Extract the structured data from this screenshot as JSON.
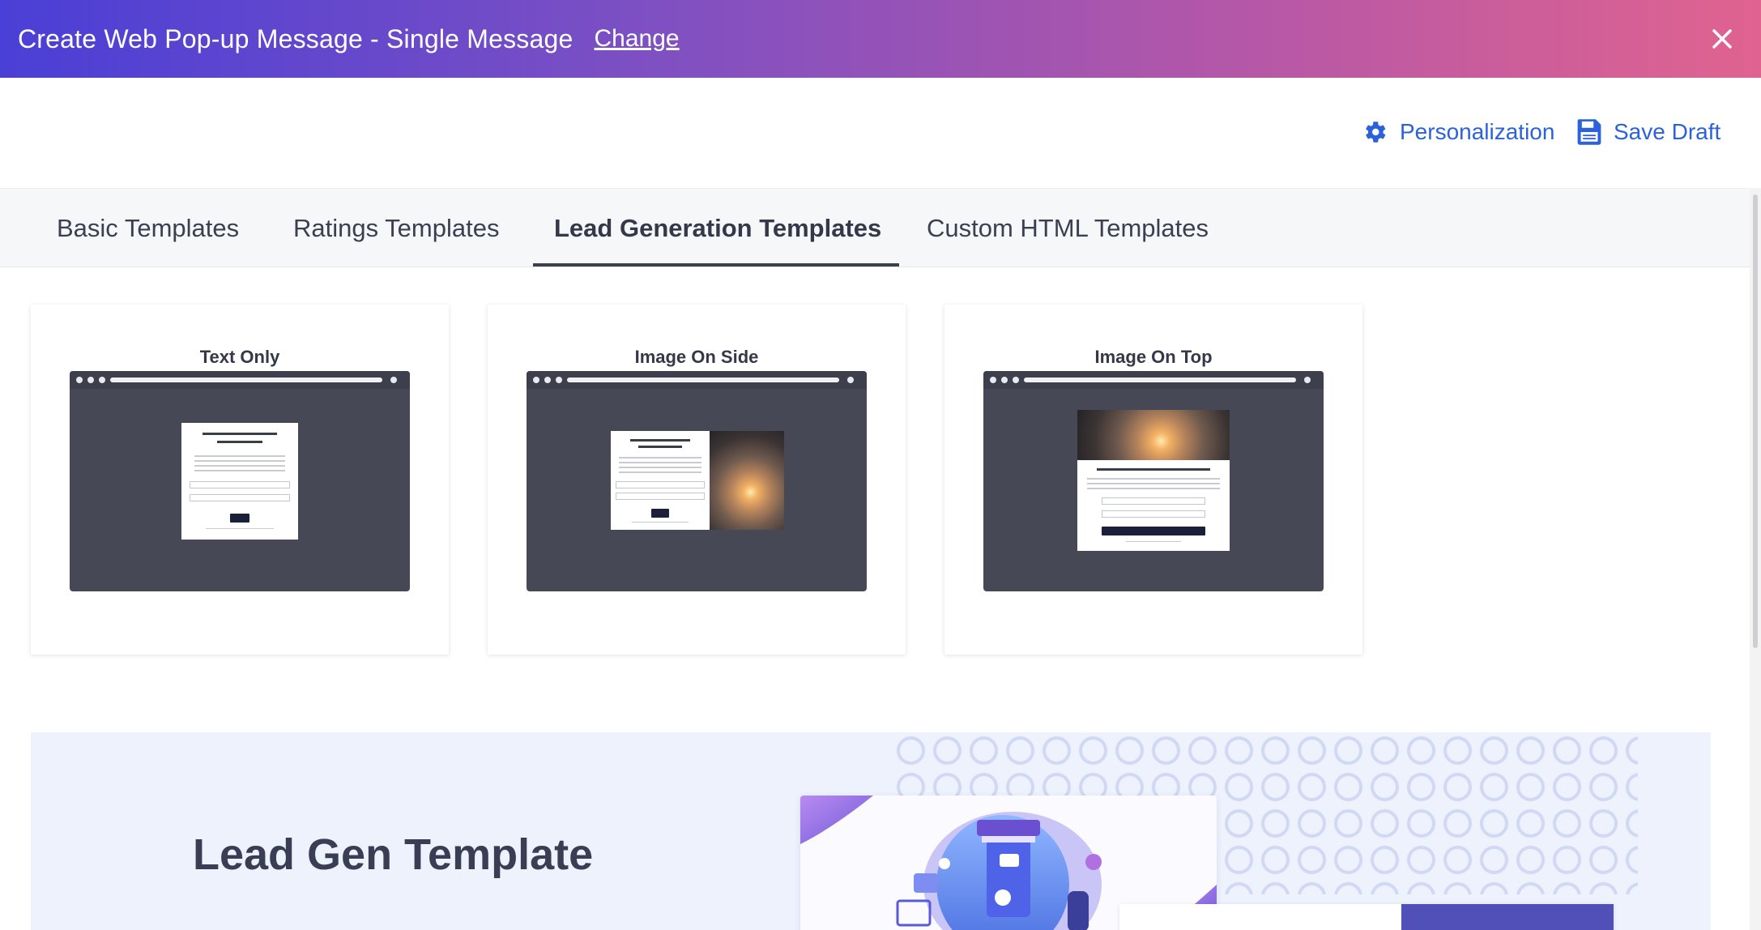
{
  "header": {
    "title": "Create Web Pop-up Message - Single Message",
    "change_label": "Change",
    "close_icon": "close-icon"
  },
  "actions": {
    "personalization_label": "Personalization",
    "personalization_icon": "gear-icon",
    "save_draft_label": "Save Draft",
    "save_draft_icon": "floppy-disk-icon"
  },
  "tabs": [
    {
      "label": "Basic Templates",
      "active": false
    },
    {
      "label": "Ratings Templates",
      "active": false
    },
    {
      "label": "Lead Generation Templates",
      "active": true
    },
    {
      "label": "Custom HTML Templates",
      "active": false
    }
  ],
  "templates": [
    {
      "title": "Text Only"
    },
    {
      "title": "Image On Side"
    },
    {
      "title": "Image On Top"
    }
  ],
  "promo": {
    "title": "Lead Gen Template"
  },
  "colors": {
    "accent": "#2b62d9",
    "header_gradient_start": "#4a3fd6",
    "header_gradient_end": "#e0638f",
    "preview_background": "#464856",
    "promo_background": "#edf2fd"
  }
}
